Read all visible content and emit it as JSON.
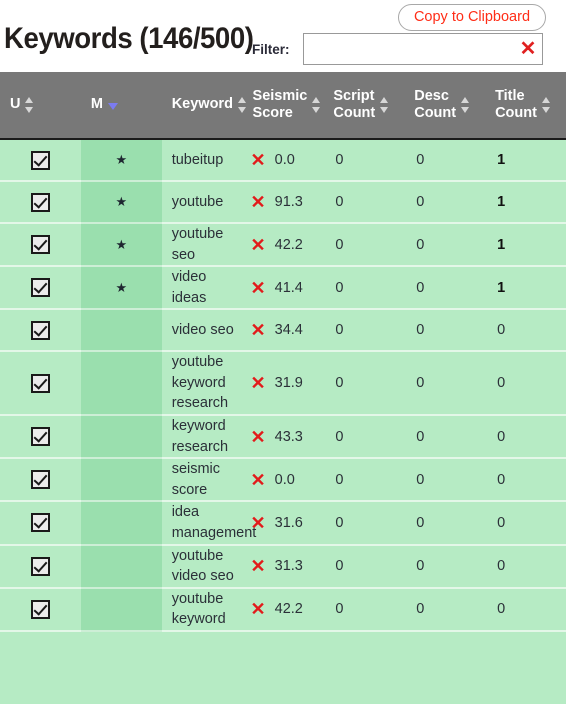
{
  "header": {
    "title": "Keywords  (146/500)",
    "copy_button_label": "Copy to Clipboard",
    "filter_label": "Filter:",
    "filter_value": "",
    "filter_placeholder": "",
    "clear_icon": "✕"
  },
  "table": {
    "columns": [
      {
        "key": "u",
        "label": "U",
        "sort": "both"
      },
      {
        "key": "m",
        "label": "M",
        "sort": "desc"
      },
      {
        "key": "keyword",
        "label": "Keyword",
        "sort": "both"
      },
      {
        "key": "seismic_score",
        "label": "Seismic\nScore",
        "sort": "both"
      },
      {
        "key": "script_count",
        "label": "Script\nCount",
        "sort": "both"
      },
      {
        "key": "desc_count",
        "label": "Desc\nCount",
        "sort": "both"
      },
      {
        "key": "title_count",
        "label": "Title\nCount",
        "sort": "both"
      }
    ],
    "icons": {
      "checkbox": "checkbox-checked",
      "star": "★",
      "delete": "✕"
    },
    "rows": [
      {
        "checked": true,
        "starred": true,
        "keyword": "tubeitup",
        "seismic_score": "0.0",
        "script_count": "0",
        "desc_count": "0",
        "title_count": "1",
        "title_bold": true
      },
      {
        "checked": true,
        "starred": true,
        "keyword": "youtube",
        "seismic_score": "91.3",
        "script_count": "0",
        "desc_count": "0",
        "title_count": "1",
        "title_bold": true
      },
      {
        "checked": true,
        "starred": true,
        "keyword": "youtube seo",
        "seismic_score": "42.2",
        "script_count": "0",
        "desc_count": "0",
        "title_count": "1",
        "title_bold": true
      },
      {
        "checked": true,
        "starred": true,
        "keyword": "video ideas",
        "seismic_score": "41.4",
        "script_count": "0",
        "desc_count": "0",
        "title_count": "1",
        "title_bold": true
      },
      {
        "checked": true,
        "starred": false,
        "keyword": "video seo",
        "seismic_score": "34.4",
        "script_count": "0",
        "desc_count": "0",
        "title_count": "0",
        "title_bold": false
      },
      {
        "checked": true,
        "starred": false,
        "keyword": "youtube keyword research",
        "seismic_score": "31.9",
        "script_count": "0",
        "desc_count": "0",
        "title_count": "0",
        "title_bold": false
      },
      {
        "checked": true,
        "starred": false,
        "keyword": "keyword research",
        "seismic_score": "43.3",
        "script_count": "0",
        "desc_count": "0",
        "title_count": "0",
        "title_bold": false
      },
      {
        "checked": true,
        "starred": false,
        "keyword": "seismic score",
        "seismic_score": "0.0",
        "script_count": "0",
        "desc_count": "0",
        "title_count": "0",
        "title_bold": false
      },
      {
        "checked": true,
        "starred": false,
        "keyword": "idea management",
        "seismic_score": "31.6",
        "script_count": "0",
        "desc_count": "0",
        "title_count": "0",
        "title_bold": false
      },
      {
        "checked": true,
        "starred": false,
        "keyword": "youtube video seo",
        "seismic_score": "31.3",
        "script_count": "0",
        "desc_count": "0",
        "title_count": "0",
        "title_bold": false
      },
      {
        "checked": true,
        "starred": false,
        "keyword": "youtube keyword",
        "seismic_score": "42.2",
        "script_count": "0",
        "desc_count": "0",
        "title_count": "0",
        "title_bold": false
      }
    ]
  },
  "colors": {
    "row_background": "#b6ebc4",
    "m_column_background": "#9adfae",
    "header_background": "#787878",
    "accent_red": "#e21b1b",
    "sort_active": "#7b7bf0"
  }
}
